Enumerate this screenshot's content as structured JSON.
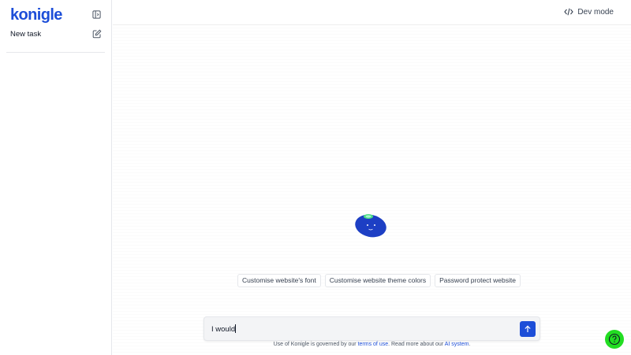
{
  "sidebar": {
    "logo_text": "konigle",
    "new_task_label": "New task",
    "icons": {
      "collapse": "sidebar-toggle-icon",
      "new_task": "edit-icon"
    }
  },
  "topbar": {
    "dev_mode_label": "Dev mode",
    "dev_mode_icon": "code-icon"
  },
  "suggestions": [
    "Customise website's font",
    "Customise website theme colors",
    "Password protect website"
  ],
  "composer": {
    "value": "I would",
    "send_icon": "arrow-up-icon"
  },
  "disclaimer": {
    "prefix": "Use of Konigle is governed by our ",
    "terms_link": "terms of use",
    "middle": ". Read more about our ",
    "ai_link": "AI system",
    "suffix": "."
  },
  "help_icon": "question-icon",
  "colors": {
    "brand": "#1d4ed8",
    "help_button": "#22dd22",
    "mascot_body": "#1d3fc4",
    "mascot_accent": "#4ade80"
  }
}
